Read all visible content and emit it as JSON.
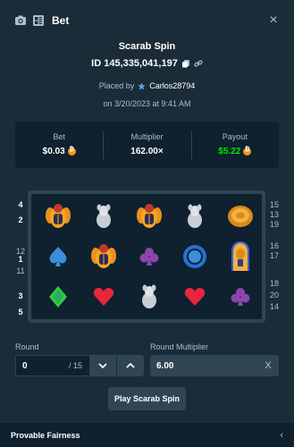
{
  "header": {
    "title": "Bet",
    "icons": [
      "camera-icon",
      "grid-icon"
    ],
    "close": "×"
  },
  "game": {
    "title": "Scarab Spin",
    "bet_id": "ID 145,335,041,197"
  },
  "placed": {
    "prefix": "Placed by",
    "user": "Carlos28794",
    "date": "on 3/20/2023 at 9:41 AM"
  },
  "stats": {
    "bet_label": "Bet",
    "bet_value": "$0.03",
    "multiplier_label": "Multiplier",
    "multiplier_value": "162.00×",
    "payout_label": "Payout",
    "payout_value": "$5.22",
    "currency_icon": "bitcoin-coin-icon",
    "payout_color": "#00e701"
  },
  "board": {
    "left_lines": [
      "4",
      "2",
      "12",
      "1",
      "11",
      "3",
      "5"
    ],
    "right_lines": [
      "15",
      "13",
      "19",
      "16",
      "17",
      "18",
      "20",
      "14"
    ],
    "rows": [
      [
        "scarab",
        "rat",
        "scarab",
        "rat",
        "coin"
      ],
      [
        "spade",
        "scarab",
        "club",
        "ring",
        "pharaoh"
      ],
      [
        "diamond",
        "heart",
        "rat",
        "heart",
        "club"
      ]
    ]
  },
  "controls": {
    "round_label": "Round",
    "round_value": "0",
    "round_total": "/ 15",
    "mult_label": "Round Multiplier",
    "mult_value": "6.00",
    "mult_clear": "X",
    "play_label": "Play Scarab Spin"
  },
  "footer": {
    "title": "Provable Fairness",
    "chevron": "‹"
  }
}
